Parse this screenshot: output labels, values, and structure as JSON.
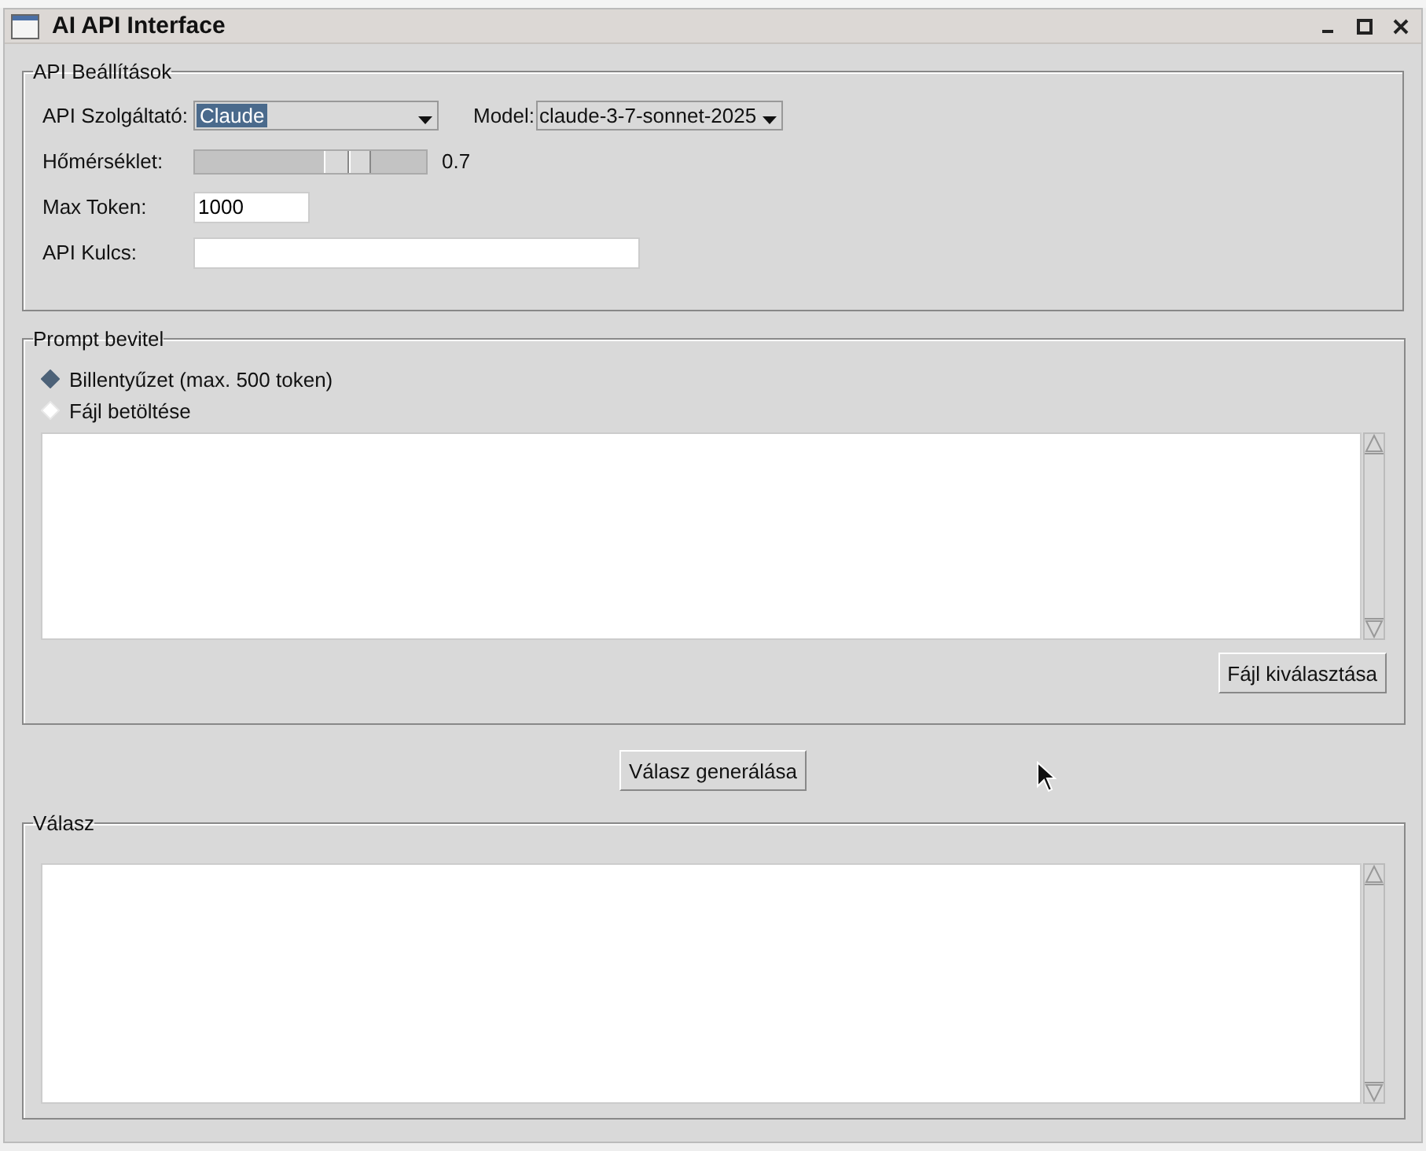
{
  "window": {
    "title": "AI API Interface"
  },
  "api_settings": {
    "title": "API Beállítások",
    "provider": {
      "label": "API Szolgáltató:",
      "value": "Claude"
    },
    "model": {
      "label": "Model:",
      "value": "claude-3-7-sonnet-2025"
    },
    "temperature": {
      "label": "Hőmérséklet:",
      "level": 0.7,
      "reading": "0.7"
    },
    "max_tokens": {
      "label": "Max Token:",
      "value": "1000"
    },
    "api_key": {
      "label": "API Kulcs:"
    }
  },
  "prompt": {
    "title": "Prompt bevitel",
    "options": [
      {
        "label": "Billentyűzet (max. 500 token)",
        "selected": true
      },
      {
        "label": "Fájl betöltése",
        "selected": false
      }
    ],
    "file_button": "Fájl kiválasztása"
  },
  "generate_button": "Válasz generálása",
  "response": {
    "title": "Válasz"
  }
}
